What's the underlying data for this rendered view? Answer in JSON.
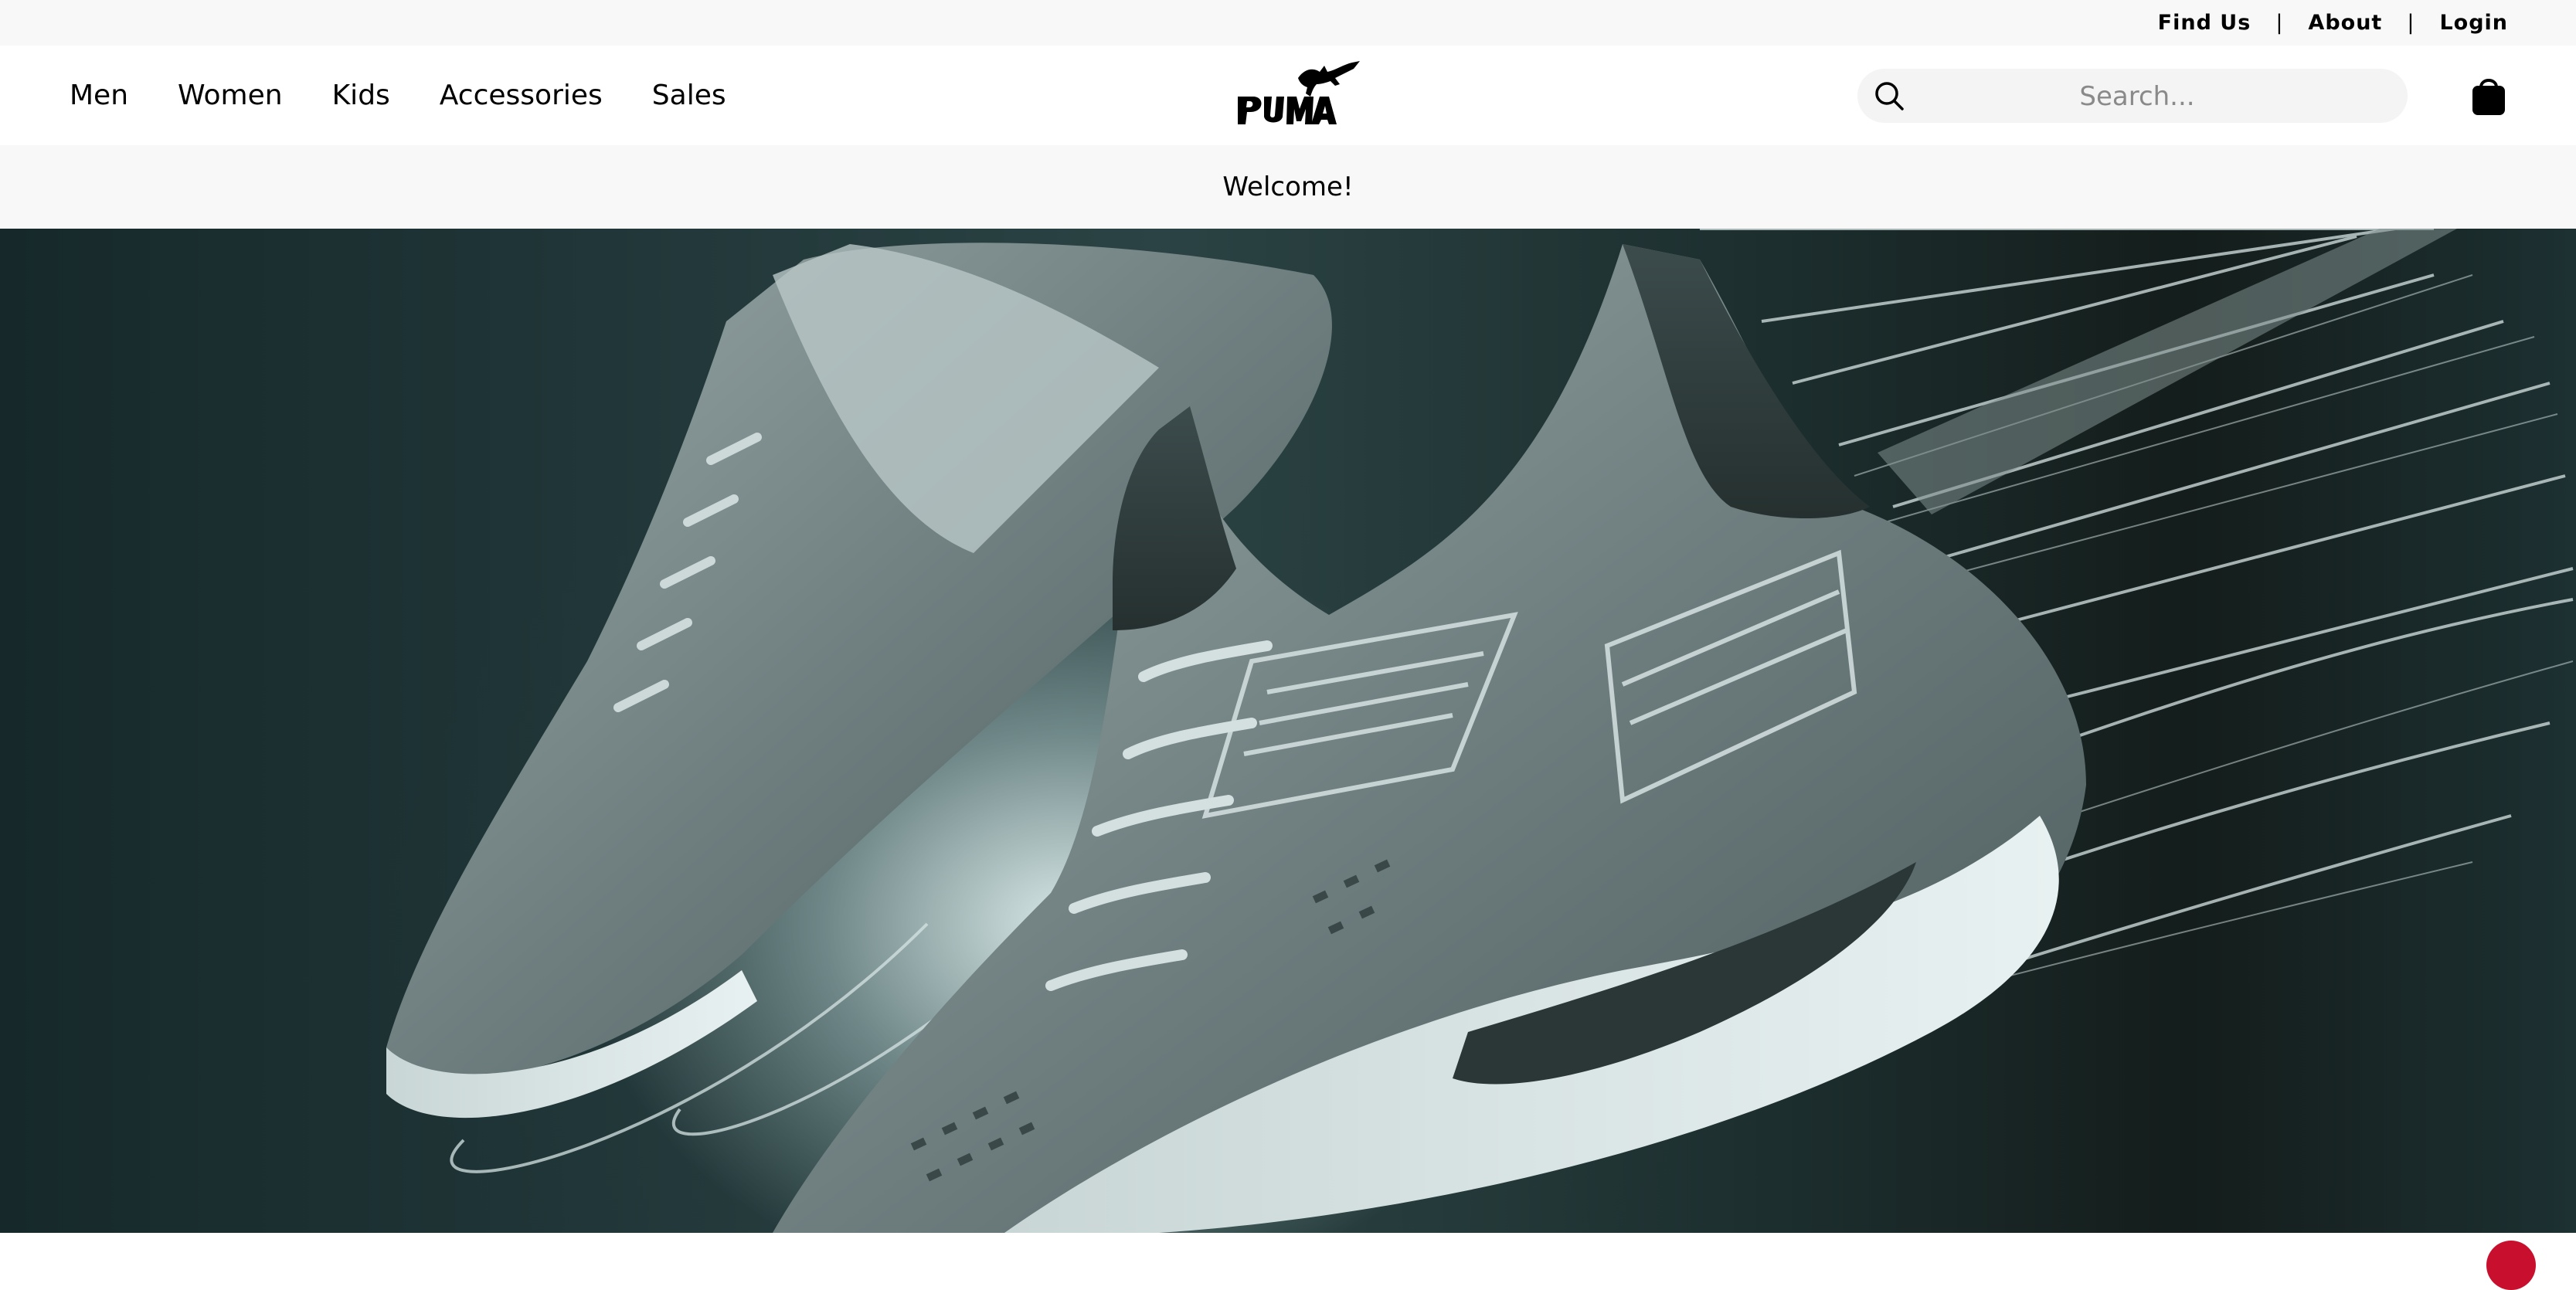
{
  "utility_bar": {
    "links": [
      "Find Us",
      "About",
      "Login"
    ],
    "separator": "|"
  },
  "header": {
    "nav": [
      "Men",
      "Women",
      "Kids",
      "Accessories",
      "Sales"
    ],
    "logo_text": "PUMA",
    "search_placeholder": "Search...",
    "search_value": "",
    "cart_icon": "shopping-bag-icon",
    "search_icon": "search-icon"
  },
  "banner": {
    "text": "Welcome!"
  },
  "hero": {
    "image": "grey-running-sneakers-hero",
    "palette": {
      "dark": "#16282a",
      "mid": "#4f6767",
      "light": "#dfeeee"
    }
  },
  "chat": {
    "icon": "chat-icon",
    "color": "#c8102e"
  }
}
